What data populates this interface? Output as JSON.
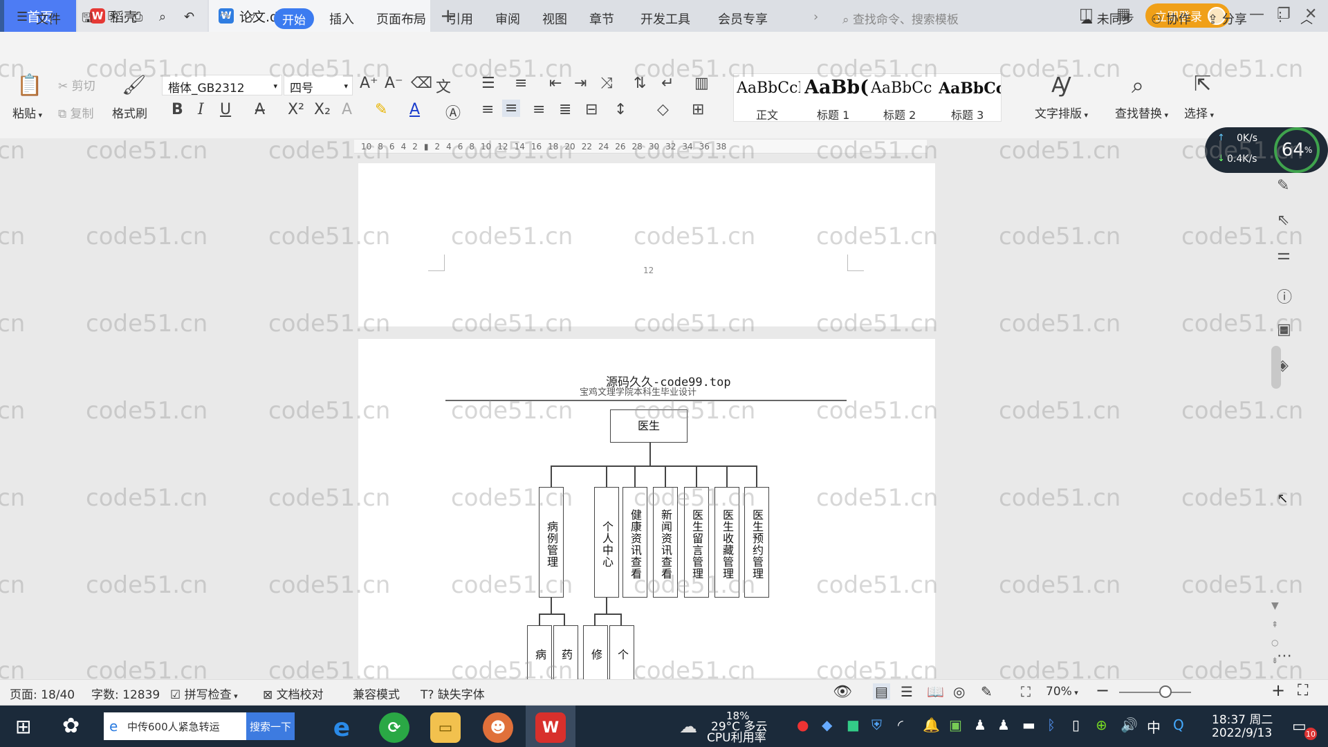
{
  "titlebar": {
    "tab_home": "首页",
    "tab_daoke": "稻壳",
    "tab_doc": "论文.doc",
    "login": "立即登录"
  },
  "menu": {
    "file": "文件",
    "start": "开始",
    "items": [
      "插入",
      "页面布局",
      "引用",
      "审阅",
      "视图",
      "章节",
      "开发工具",
      "会员专享"
    ],
    "search": "查找命令、搜索模板",
    "unsync": "未同步",
    "collab": "协作",
    "share": "分享"
  },
  "ribbon": {
    "paste": "粘贴",
    "cut": "剪切",
    "copy": "复制",
    "format_painter": "格式刷",
    "font_name": "楷体_GB2312",
    "font_size": "四号",
    "styles": [
      {
        "preview": "AaBbCcI",
        "label": "正文"
      },
      {
        "preview": "AaBb(",
        "label": "标题 1"
      },
      {
        "preview": "AaBbCc",
        "label": "标题 2"
      },
      {
        "preview": "AaBbCcl",
        "label": "标题 3"
      }
    ],
    "text_layout": "文字排版",
    "find_replace": "查找替换",
    "select": "选择"
  },
  "ruler": [
    "10",
    "8",
    "6",
    "4",
    "2",
    "",
    "2",
    "4",
    "6",
    "8",
    "10",
    "12",
    "14",
    "16",
    "18",
    "20",
    "22",
    "24",
    "26",
    "28",
    "30",
    "32",
    "34",
    "36",
    "38"
  ],
  "network": {
    "up": "0K/s",
    "down": "0.4K/s",
    "percent": "64",
    "percent_unit": "%"
  },
  "document": {
    "page_number": "12",
    "header_title": "源码久久-code99.top",
    "header_sub": "宝鸡文理学院本科生毕业设计",
    "root": "医生",
    "branches": [
      "病例管理",
      "个人中心",
      "健康资讯查看",
      "新闻资讯查看",
      "医生留言管理",
      "医生收藏管理",
      "医生预约管理"
    ],
    "sub_nodes": [
      "病",
      "药",
      "修",
      "个"
    ]
  },
  "watermark": "code51.cn",
  "statusbar": {
    "page": "页面: 18/40",
    "words": "字数: 12839",
    "spell": "拼写检查",
    "proof": "文档校对",
    "compat": "兼容模式",
    "missing_font": "缺失字体",
    "zoom": "70%"
  },
  "taskbar": {
    "news": "中传600人紧急转运",
    "search_btn": "搜索一下",
    "weather": "29°C 多云",
    "cpu_pct": "18%",
    "cpu_label": "CPU利用率",
    "ime": "中",
    "time": "18:37 周二",
    "date": "2022/9/13",
    "notif_count": "10"
  }
}
